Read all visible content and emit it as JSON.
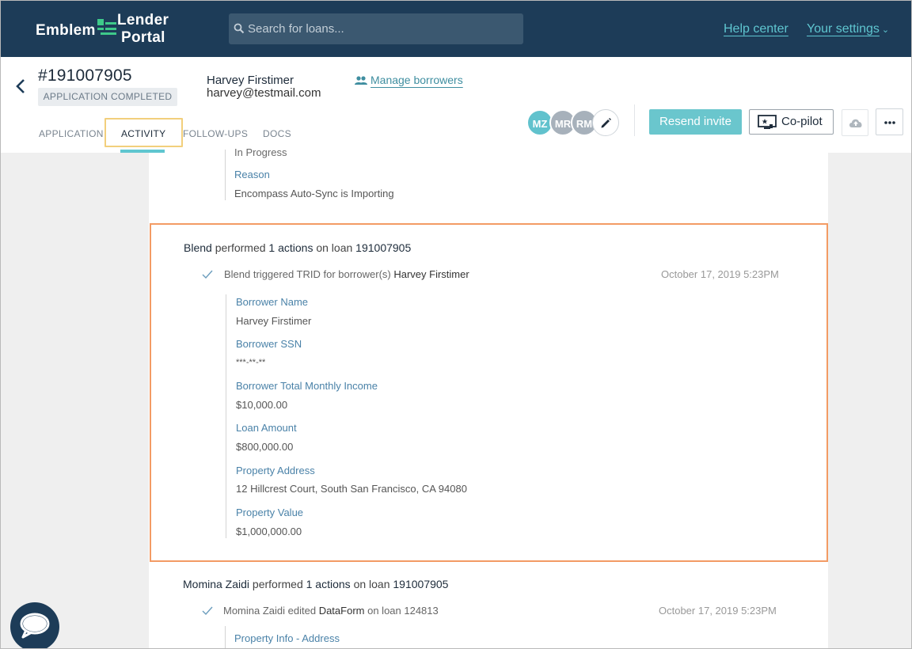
{
  "nav": {
    "logo_emblem": "Emblem",
    "logo_lender": "Lender",
    "logo_portal": "Portal",
    "search_placeholder": "Search for loans...",
    "help_center": "Help center",
    "your_settings": "Your settings"
  },
  "header": {
    "loan_id": "#191007905",
    "status": "APPLICATION COMPLETED",
    "borrower_name": "Harvey Firstimer",
    "borrower_email": "harvey@testmail.com",
    "manage_borrowers": "Manage borrowers",
    "tabs": [
      {
        "label": "APPLICATION"
      },
      {
        "label": "ACTIVITY"
      },
      {
        "label": "FOLLOW-UPS"
      },
      {
        "label": "DOCS"
      }
    ],
    "active_tab": "ACTIVITY",
    "avatars": [
      "MZ",
      "MR",
      "RM"
    ],
    "resend_invite": "Resend invite",
    "copilot": "Co-pilot"
  },
  "activity": {
    "prev": {
      "value_top": "In Progress",
      "reason_label": "Reason",
      "reason_value": "Encompass Auto-Sync is Importing"
    },
    "card1": {
      "actor": "Blend",
      "performed": "performed",
      "count": "1 actions",
      "on_loan": "on loan",
      "loan": "191007905",
      "action_prefix": "Blend triggered TRID for borrower(s)",
      "action_target": "Harvey Firstimer",
      "timestamp": "October 17, 2019 5:23PM",
      "fields": [
        {
          "label": "Borrower Name",
          "value": "Harvey Firstimer"
        },
        {
          "label": "Borrower SSN",
          "value": "***-**-**"
        },
        {
          "label": "Borrower Total Monthly Income",
          "value": "$10,000.00"
        },
        {
          "label": "Loan Amount",
          "value": "$800,000.00"
        },
        {
          "label": "Property Address",
          "value": "12 Hillcrest Court, South San Francisco, CA 94080"
        },
        {
          "label": "Property Value",
          "value": "$1,000,000.00"
        }
      ]
    },
    "card2": {
      "actor": "Momina Zaidi",
      "performed": "performed",
      "count": "1 actions",
      "on_loan": "on loan",
      "loan": "191007905",
      "action_prefix": "Momina Zaidi edited",
      "action_target": "DataForm",
      "action_suffix": "on loan 124813",
      "timestamp": "October 17, 2019 5:23PM",
      "first_field_label": "Property Info - Address"
    }
  },
  "colors": {
    "nav_bg": "#1d3c58",
    "accent": "#5fc6d0",
    "highlight_border": "#f39b64",
    "tab_highlight": "#f2cf7c"
  }
}
